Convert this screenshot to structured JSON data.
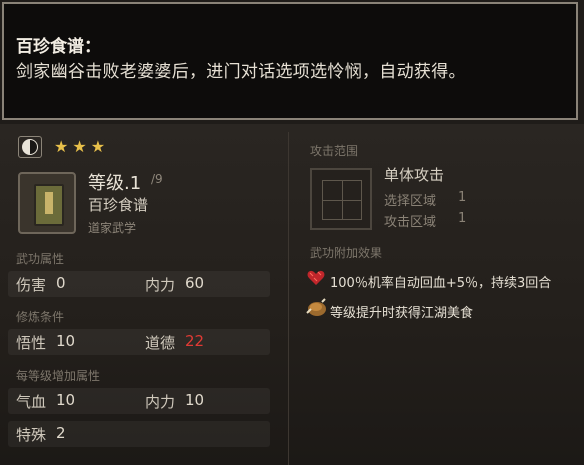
{
  "tooltip": {
    "title": "百珍食谱：",
    "description": "剑家幽谷击败老婆婆后，进门对话选项选怜悯，自动获得。"
  },
  "skill": {
    "stars": "★★★",
    "level": "等级.1",
    "level_max": "/9",
    "name": "百珍食谱",
    "school": "道家武学"
  },
  "attributes": {
    "section_title": "武功属性",
    "damage_label": "伤害",
    "damage_value": "0",
    "neili_label": "内力",
    "neili_value": "60"
  },
  "requirements": {
    "section_title": "修炼条件",
    "wuxing_label": "悟性",
    "wuxing_value": "10",
    "daode_label": "道德",
    "daode_value": "22"
  },
  "per_level": {
    "section_title": "每等级增加属性",
    "qixue_label": "气血",
    "qixue_value": "10",
    "neili_label": "内力",
    "neili_value": "10",
    "teshu_label": "特殊",
    "teshu_value": "2"
  },
  "range": {
    "section_title": "攻击范围",
    "type": "单体攻击",
    "select_label": "选择区域",
    "select_value": "1",
    "attack_label": "攻击区域",
    "attack_value": "1"
  },
  "effects": {
    "section_title": "武功附加效果",
    "items": [
      {
        "icon": "red-heal-icon",
        "text": "100％机率自动回血+5％，持续3回合"
      },
      {
        "icon": "roast-chicken-icon",
        "text": "等级提升时获得江湖美食"
      }
    ]
  },
  "colors": {
    "star": "#e8c04a",
    "insufficient": "#e03a34"
  }
}
